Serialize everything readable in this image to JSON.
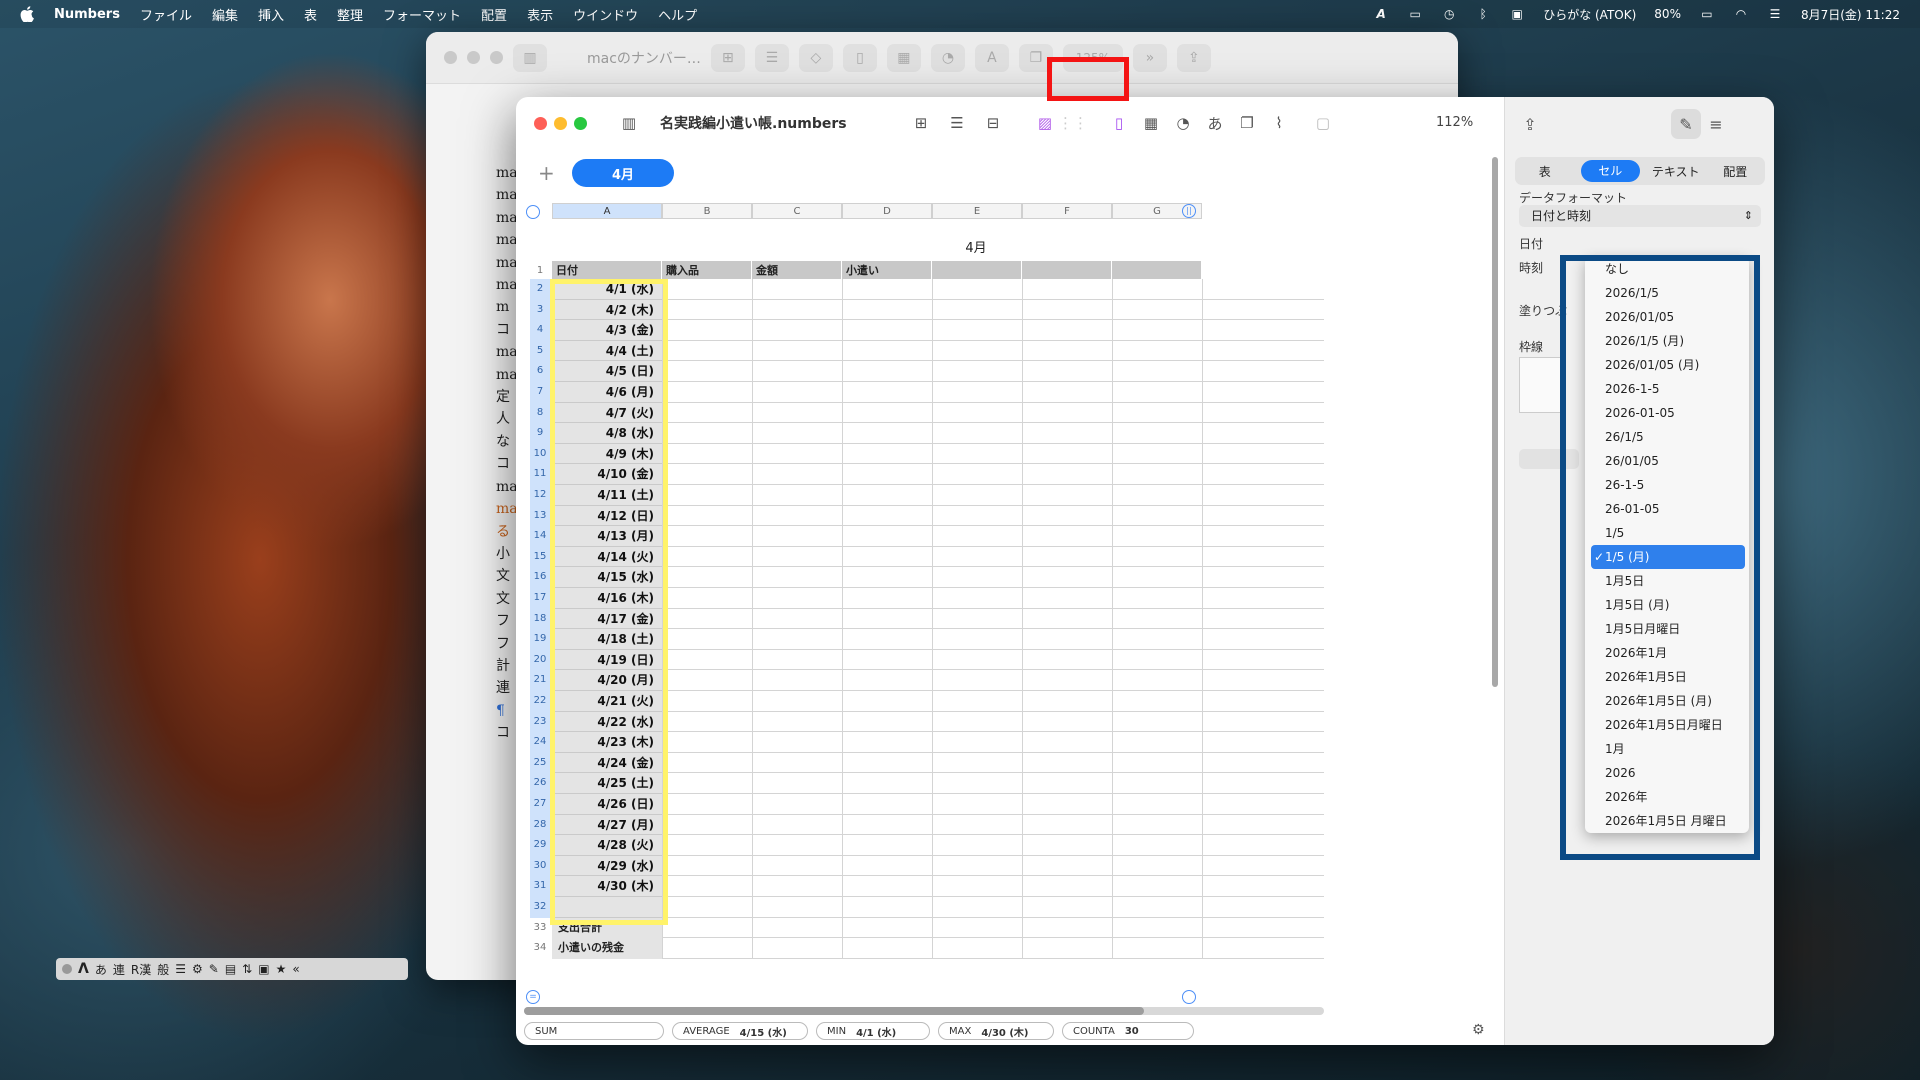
{
  "menubar": {
    "app": "Numbers",
    "items": [
      "ファイル",
      "編集",
      "挿入",
      "表",
      "整理",
      "フォーマット",
      "配置",
      "表示",
      "ウインドウ",
      "ヘルプ"
    ],
    "input_method": "ひらがな (ATOK)",
    "battery": "80%",
    "datetime": "8月7日(金) 11:22"
  },
  "back_window": {
    "title": "macのナンバー…",
    "zoom": "125%",
    "doc_chars": [
      "ma",
      "ma",
      "ma",
      "ma",
      "ma",
      "ma",
      "m",
      "コ",
      "ma",
      "ma",
      "定",
      "人",
      "な",
      "コ",
      "ma",
      "ma",
      "る",
      "小",
      "文",
      "文",
      "フ",
      "フ",
      "計",
      "連",
      "¶",
      "コ"
    ]
  },
  "ime_bar": {
    "items": [
      "あ",
      "連",
      "R漢",
      "般"
    ]
  },
  "window": {
    "title": "名実践編小遣い帳.numbers",
    "zoom": "112%",
    "sheet_tab": "4月",
    "add_sheet": "+",
    "columns": [
      "A",
      "B",
      "C",
      "D",
      "E",
      "F",
      "G"
    ],
    "table_title": "4月",
    "header_row": [
      "日付",
      "購入品",
      "金額",
      "小遣い",
      "",
      "",
      ""
    ],
    "dates": [
      "4/1 (水)",
      "4/2 (木)",
      "4/3 (金)",
      "4/4 (土)",
      "4/5 (日)",
      "4/6 (月)",
      "4/7 (火)",
      "4/8 (水)",
      "4/9 (木)",
      "4/10 (金)",
      "4/11 (土)",
      "4/12 (日)",
      "4/13 (月)",
      "4/14 (火)",
      "4/15 (水)",
      "4/16 (木)",
      "4/17 (金)",
      "4/18 (土)",
      "4/19 (日)",
      "4/20 (月)",
      "4/21 (火)",
      "4/22 (水)",
      "4/23 (木)",
      "4/24 (金)",
      "4/25 (土)",
      "4/26 (日)",
      "4/27 (月)",
      "4/28 (火)",
      "4/29 (水)",
      "4/30 (木)",
      ""
    ],
    "footer_rows": [
      "支出合計",
      "小遣いの残金"
    ],
    "row_numbers": [
      "1",
      "2",
      "3",
      "4",
      "5",
      "6",
      "7",
      "8",
      "9",
      "10",
      "11",
      "12",
      "13",
      "14",
      "15",
      "16",
      "17",
      "18",
      "19",
      "20",
      "21",
      "22",
      "23",
      "24",
      "25",
      "26",
      "27",
      "28",
      "29",
      "30",
      "31",
      "32",
      "33",
      "34"
    ],
    "status": [
      {
        "label": "SUM",
        "value": ""
      },
      {
        "label": "AVERAGE",
        "value": "4/15 (水)"
      },
      {
        "label": "MIN",
        "value": "4/1 (水)"
      },
      {
        "label": "MAX",
        "value": "4/30 (木)"
      },
      {
        "label": "COUNTA",
        "value": "30"
      }
    ]
  },
  "inspector": {
    "tabs": [
      "表",
      "セル",
      "テキスト",
      "配置"
    ],
    "active_tab": "セル",
    "data_format_label": "データフォーマット",
    "data_format_value": "日付と時刻",
    "partial_labels": [
      "日付",
      "時刻",
      "塗りつぶ",
      "枠線"
    ],
    "date_formats": [
      "なし",
      "2026/1/5",
      "2026/01/05",
      "2026/1/5 (月)",
      "2026/01/05 (月)",
      "2026-1-5",
      "2026-01-05",
      "26/1/5",
      "26/01/05",
      "26-1-5",
      "26-01-05",
      "1/5",
      "1/5 (月)",
      "1月5日",
      "1月5日 (月)",
      "1月5日月曜日",
      "2026年1月",
      "2026年1月5日",
      "2026年1月5日 (月)",
      "2026年1月5日月曜日",
      "1月",
      "2026",
      "2026年",
      "2026年1月5日 月曜日"
    ],
    "selected_format": "1/5 (月)"
  },
  "colors": {
    "accent": "#1d7bf5",
    "highlight_yellow": "#fff36a",
    "highlight_red": "#f41414",
    "highlight_blue": "#0b4a85"
  }
}
